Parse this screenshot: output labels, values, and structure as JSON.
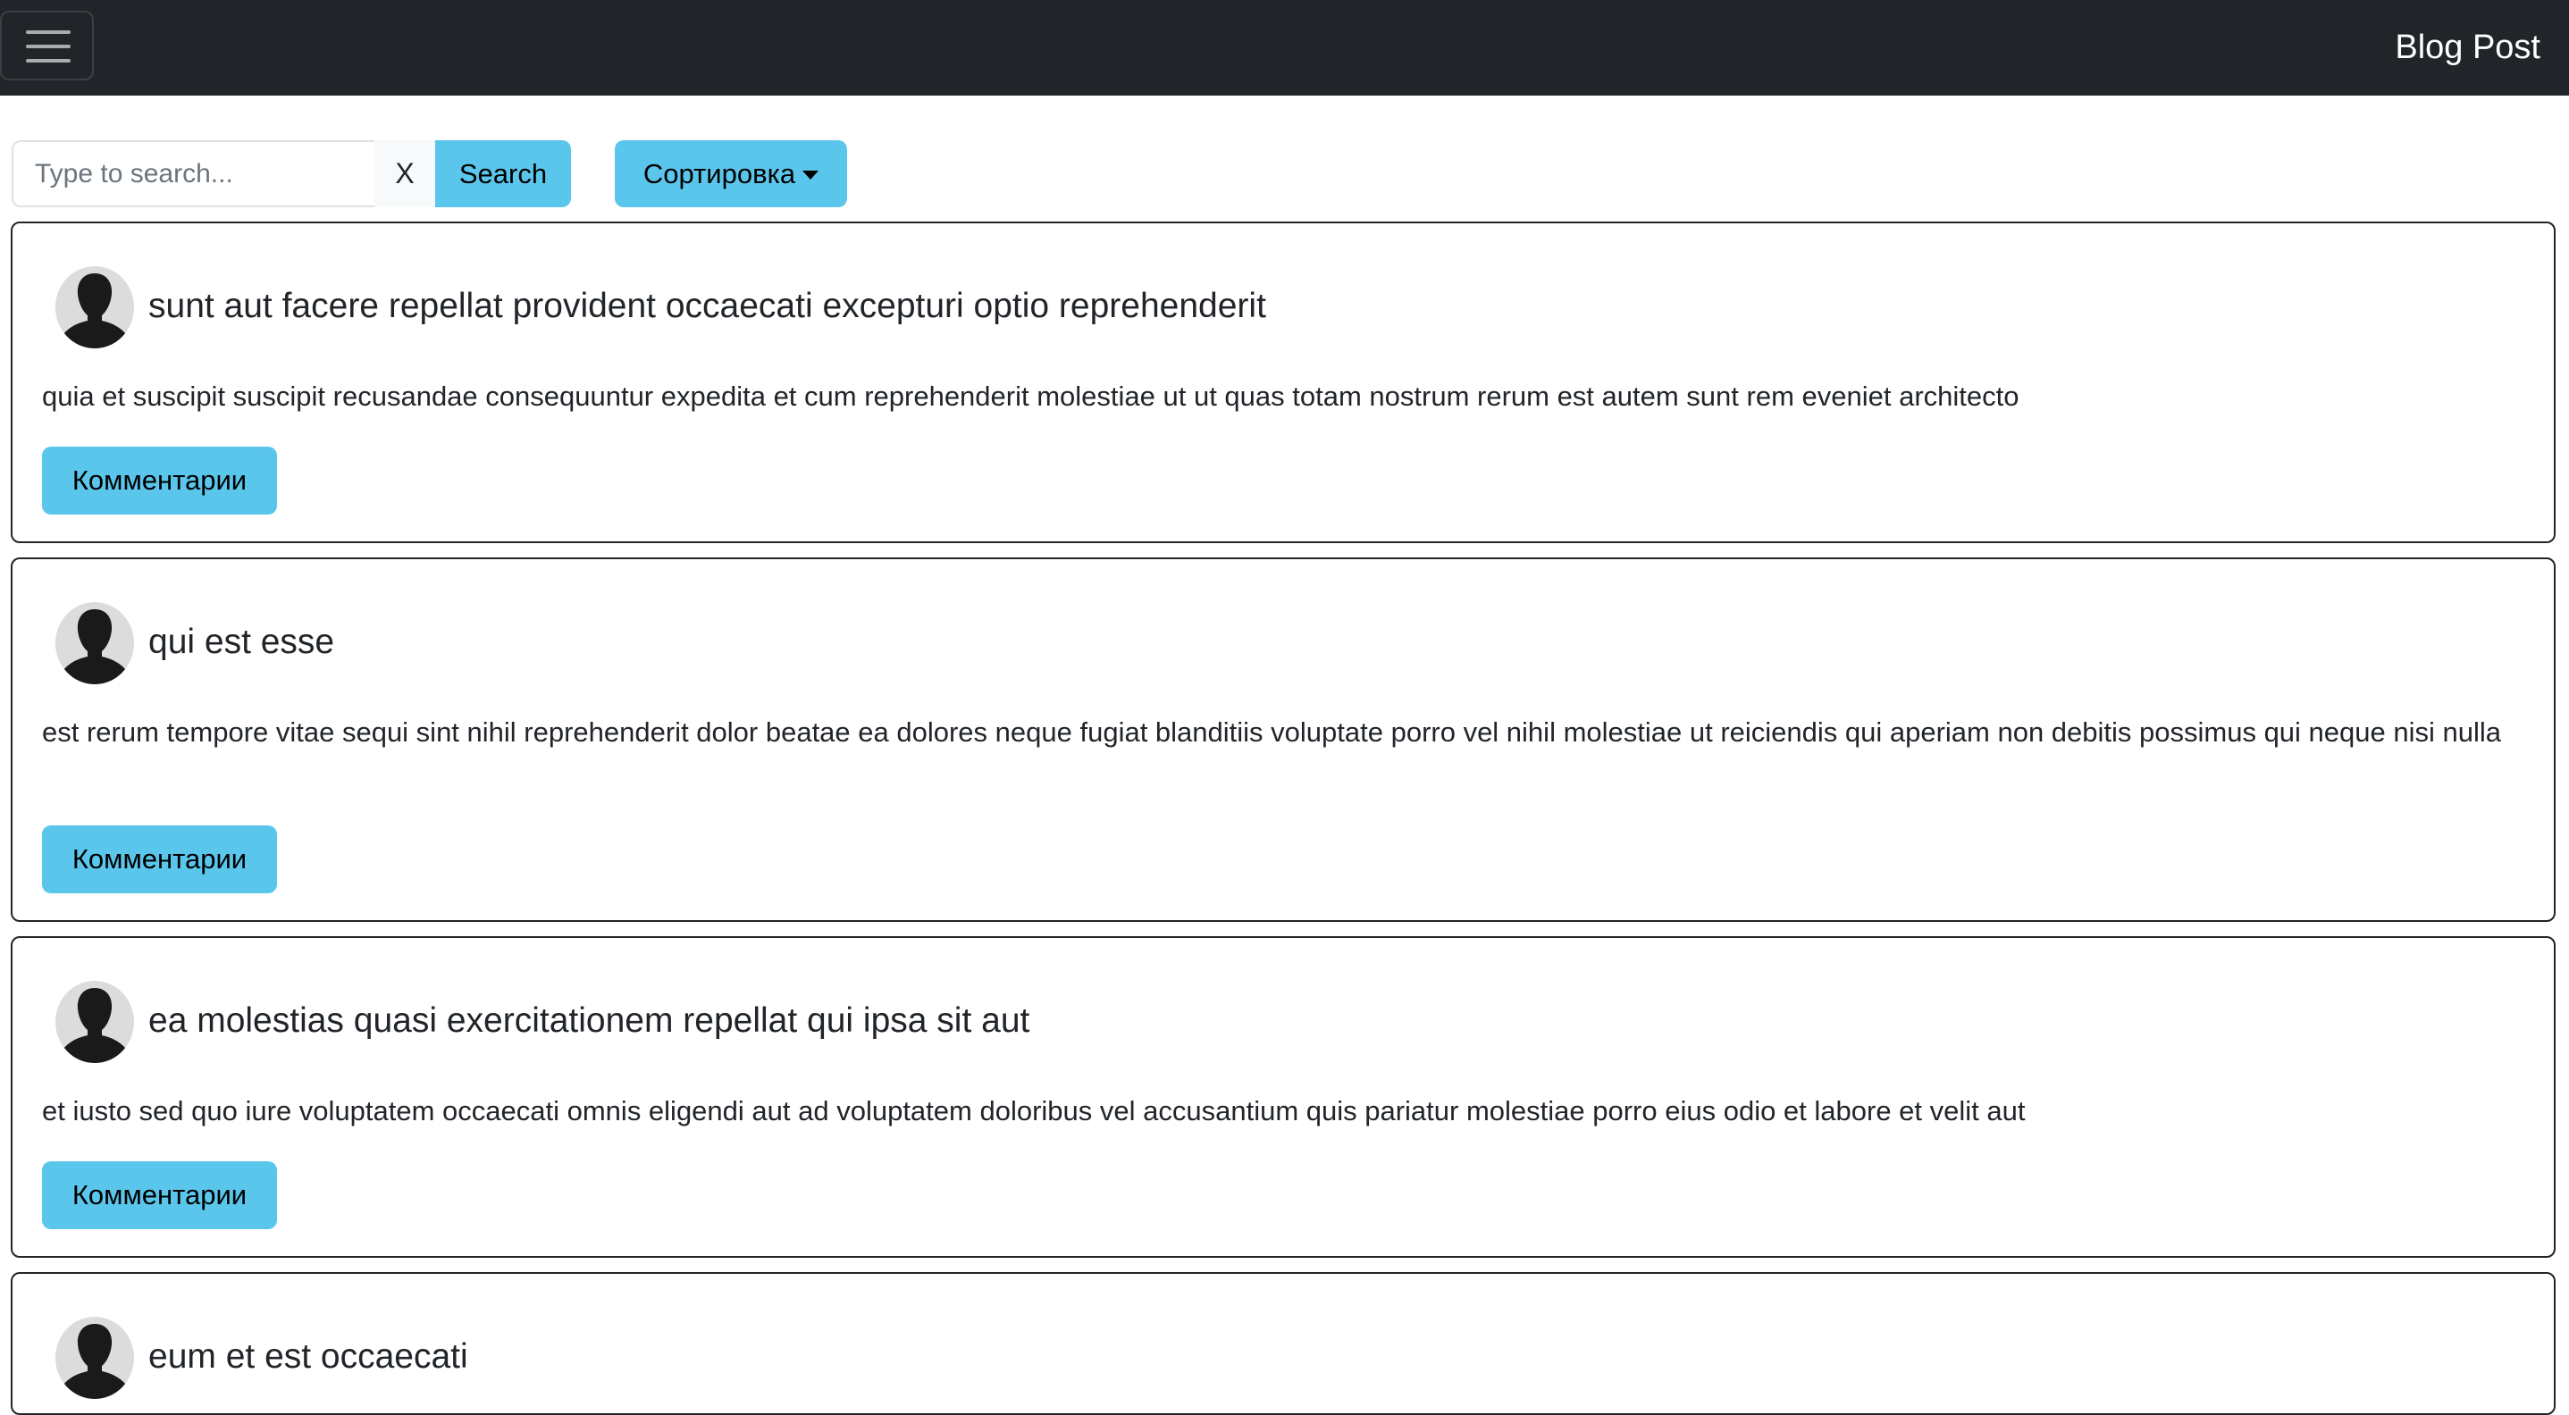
{
  "navbar": {
    "brand": "Blog Post",
    "menu_icon": "hamburger-menu-icon"
  },
  "toolbar": {
    "search_placeholder": "Type to search...",
    "search_value": "",
    "clear_label": "X",
    "search_label": "Search",
    "sort_label": "Сортировка",
    "sort_icon": "caret-down-icon"
  },
  "posts": [
    {
      "title": "sunt aut facere repellat provident occaecati excepturi optio reprehenderit",
      "body": "quia et suscipit suscipit recusandae consequuntur expedita et cum reprehenderit molestiae ut ut quas totam nostrum rerum est autem sunt rem eveniet architecto",
      "comments_label": "Комментарии"
    },
    {
      "title": "qui est esse",
      "body": "est rerum tempore vitae sequi sint nihil reprehenderit dolor beatae ea dolores neque fugiat blanditiis voluptate porro vel nihil molestiae ut reiciendis qui aperiam non debitis possimus qui neque nisi nulla",
      "comments_label": "Комментарии"
    },
    {
      "title": "ea molestias quasi exercitationem repellat qui ipsa sit aut",
      "body": "et iusto sed quo iure voluptatem occaecati omnis eligendi aut ad voluptatem doloribus vel accusantium quis pariatur molestiae porro eius odio et labore et velit aut",
      "comments_label": "Комментарии"
    },
    {
      "title": "eum et est occaecati"
    }
  ],
  "colors": {
    "navbar_bg": "#212529",
    "accent": "#5bc6ec",
    "border": "#212529",
    "avatar_bg": "#dcdcdc"
  }
}
